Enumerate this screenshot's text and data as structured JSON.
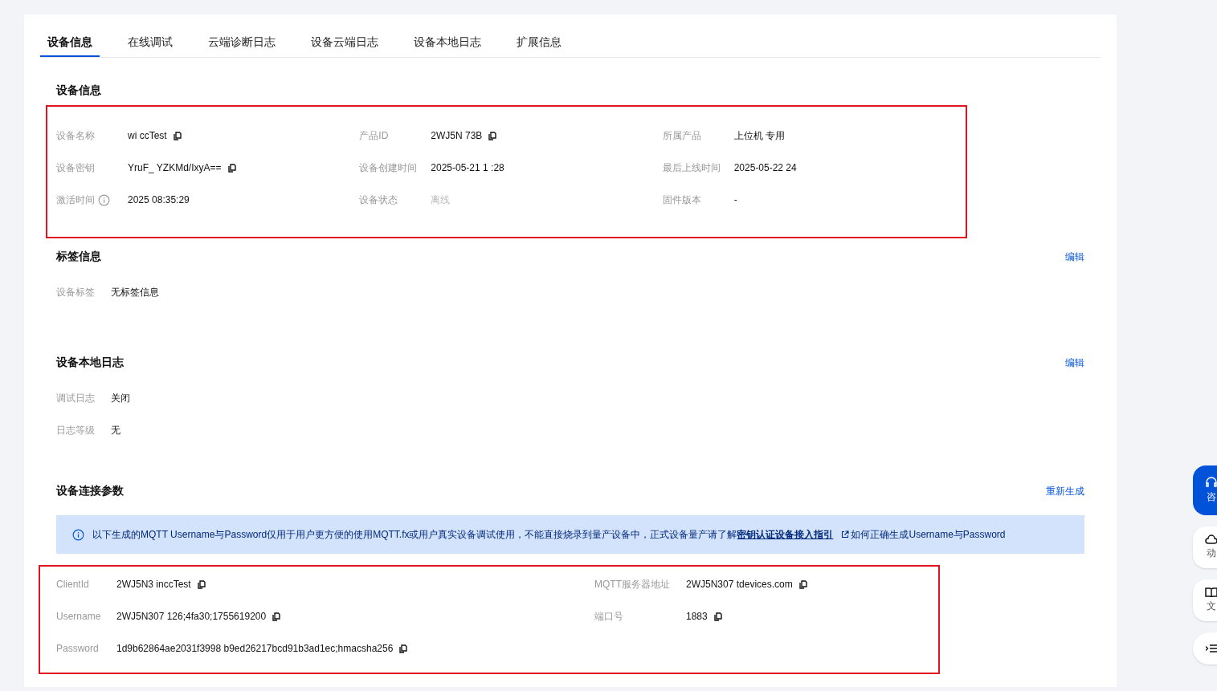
{
  "tabs": [
    {
      "label": "设备信息",
      "selected": true
    },
    {
      "label": "在线调试",
      "selected": false
    },
    {
      "label": "云端诊断日志",
      "selected": false
    },
    {
      "label": "设备云端日志",
      "selected": false
    },
    {
      "label": "设备本地日志",
      "selected": false
    },
    {
      "label": "扩展信息",
      "selected": false
    }
  ],
  "device_info": {
    "title": "设备信息",
    "fields": [
      {
        "label": "设备名称",
        "value": "wi ccTest",
        "copy": true
      },
      {
        "label": "产品ID",
        "value": "2WJ5N 73B",
        "copy": true
      },
      {
        "label": "所属产品",
        "value": "上位机 专用",
        "copy": false
      },
      {
        "label": "设备密钥",
        "value": "YruF_ YZKMd/IxyA==",
        "copy": true
      },
      {
        "label": "设备创建时间",
        "value": "2025-05-21 1 :28",
        "copy": false
      },
      {
        "label": "最后上线时间",
        "value": "2025-05-22 24",
        "copy": false
      },
      {
        "label": "激活时间",
        "value": "2025 08:35:29",
        "copy": false,
        "info": true
      },
      {
        "label": "设备状态",
        "value": "离线",
        "copy": false,
        "muted": true
      },
      {
        "label": "固件版本",
        "value": "-",
        "copy": false
      }
    ]
  },
  "tag_info": {
    "title": "标签信息",
    "action": "编辑",
    "fields": [
      {
        "label": "设备标签",
        "value": "无标签信息"
      }
    ]
  },
  "local_log": {
    "title": "设备本地日志",
    "action": "编辑",
    "fields": [
      {
        "label": "调试日志",
        "value": "关闭"
      },
      {
        "label": "日志等级",
        "value": "无"
      }
    ]
  },
  "connection": {
    "title": "设备连接参数",
    "action": "重新生成",
    "notice": {
      "text": "以下生成的MQTT Username与Password仅用于用户更方便的使用MQTT.fx或用户真实设备调试使用，不能直接烧录到量产设备中，正式设备量产请了解",
      "link": "密钥认证设备接入指引",
      "link2": "如何正确生成Username与Password"
    },
    "fields": [
      {
        "label": "ClientId",
        "value": "2WJ5N3 inccTest"
      },
      {
        "label": "MQTT服务器地址",
        "value": "2WJ5N307 tdevices.com"
      },
      {
        "label": "Username",
        "value": "2WJ5N307 126;4fa30;1755619200"
      },
      {
        "label": "端口号",
        "value": "1883"
      },
      {
        "label": "Password",
        "value": "1d9b62864ae2031f3998 b9ed26217bcd91b3ad1ec;hmacsha256"
      }
    ]
  },
  "float_buttons": [
    {
      "label": "咨",
      "kind": "primary"
    },
    {
      "label": "动",
      "kind": "cloud"
    },
    {
      "label": "文",
      "kind": "book"
    }
  ]
}
